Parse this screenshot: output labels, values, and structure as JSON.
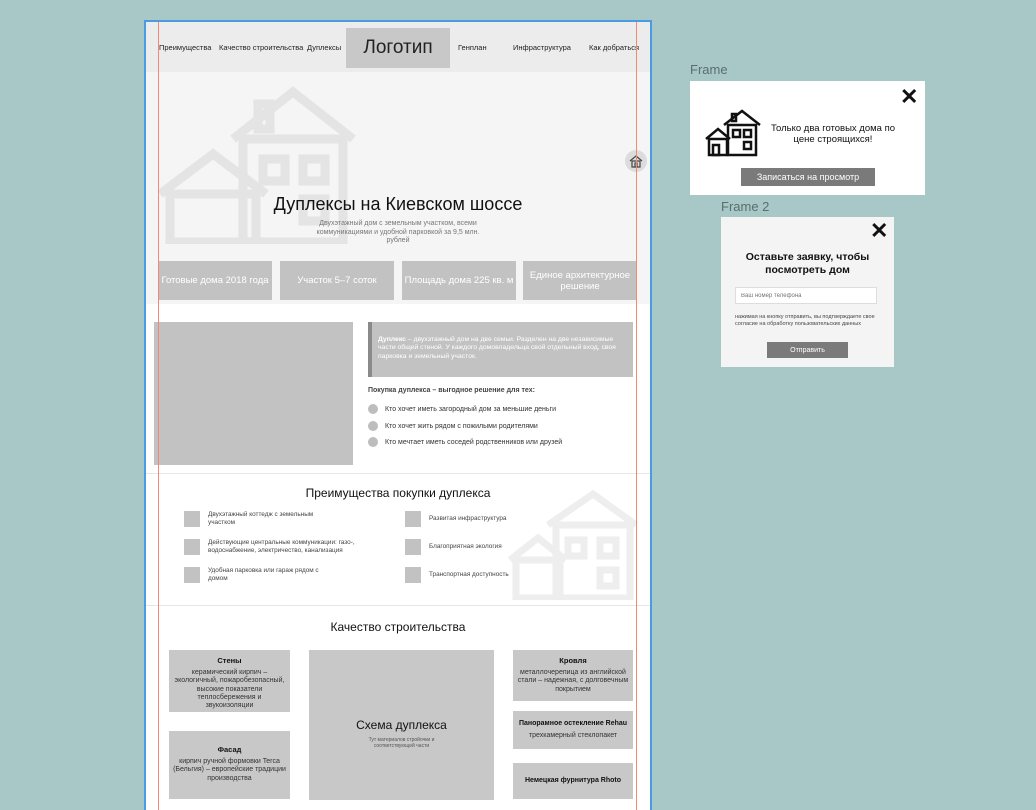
{
  "nav": {
    "items": [
      "Преимущества",
      "Качество строительства",
      "Дуплексы",
      "Генплан",
      "Инфраструктура",
      "Как добраться"
    ],
    "logo": "Логотип"
  },
  "hero": {
    "title": "Дуплексы на Киевском шоссе",
    "subtitle": "Двухэтажный дом с земельным участком, всеми коммуникациями и удобной парковкой за 9,5 млн. рублей"
  },
  "features": [
    "Готовые дома 2018 года",
    "Участок 5–7 соток",
    "Площадь дома 225 кв. м",
    "Единое архитектурное решение"
  ],
  "about": {
    "term": "Дуплекс",
    "definition": " – двухэтажный дом на две семьи. Разделен на две независимые части общей стеной. У каждого домовладельца свой отдельный вход, своя парковка и земельный участок.",
    "lead": "Покупка дуплекса – выгодное решение для тех:",
    "bullets": [
      "Кто хочет иметь загородный дом за меньшие деньги",
      "Кто хочет жить рядом с пожилыми родителями",
      "Кто мечтает иметь соседей родственников или друзей"
    ]
  },
  "advantages": {
    "title": "Преимущества покупки дуплекса",
    "left": [
      "Двухэтажный коттедж с земельным участком",
      "Действующие центральные коммуникации: газо-, водоснабжение, электричество, канализация",
      "Удобная парковка или гараж рядом с домом"
    ],
    "right": [
      "Развитая инфраструктура",
      "Благоприятная экология",
      "Транспортная доступность"
    ]
  },
  "quality": {
    "title": "Качество строительства",
    "walls": {
      "title": "Стены",
      "text": "керамический кирпич – экологичный, пожаробезопасный, высокие показатели теплосбережения и звукоизоляции"
    },
    "facade": {
      "title": "Фасад",
      "text": "кирпич ручной формовки Terca (Бельгия) – европейские традиции производства"
    },
    "scheme": {
      "title": "Схема дуплекса",
      "text": "Тут материалов стройочки и соответствующей части"
    },
    "roof": {
      "title": "Кровля",
      "text": "металлочерепица из английской стали – надежная, с долговечным покрытием"
    },
    "glazing": {
      "title": "Панорамное остекление Rehau",
      "text": "трехкамерный стеклопакет"
    },
    "fittings": {
      "title": "Немецкая фурнитура Rhoto"
    }
  },
  "popup1": {
    "label": "Frame",
    "text": "Только два готовых дома по цене строящихся!",
    "button": "Записаться на просмотр"
  },
  "popup2": {
    "label": "Frame 2",
    "title": "Оставьте заявку, чтобы посмотреть дом",
    "placeholder": "Ваш номер телефона",
    "note": "нажимая на кнопку отправить, вы подтверждаете свое согласие на обработку пользовательских данных",
    "button": "Отправить"
  },
  "colors": {
    "background": "#a8c8c8",
    "frame_border": "#4a9be0",
    "guide": "#f08a78",
    "block": "#c2c2c2",
    "button": "#7a7a7a"
  }
}
